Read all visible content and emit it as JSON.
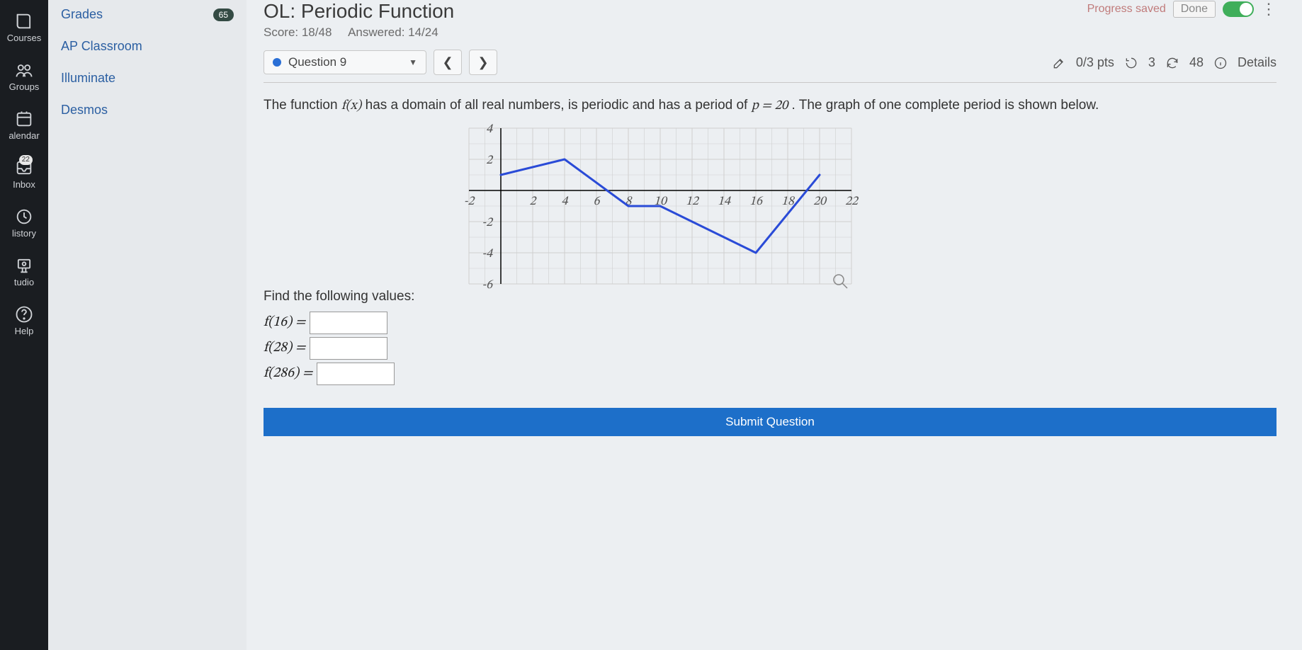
{
  "leftrail": {
    "items": [
      {
        "name": "courses",
        "label": "Courses",
        "icon": "book"
      },
      {
        "name": "groups",
        "label": "Groups",
        "icon": "people"
      },
      {
        "name": "calendar",
        "label": "alendar",
        "icon": "calendar"
      },
      {
        "name": "inbox",
        "label": "Inbox",
        "icon": "inbox",
        "badge": "22"
      },
      {
        "name": "history",
        "label": "listory",
        "icon": "clock"
      },
      {
        "name": "studio",
        "label": "tudio",
        "icon": "studio"
      },
      {
        "name": "help",
        "label": "Help",
        "icon": "help"
      }
    ]
  },
  "secondnav": {
    "items": [
      {
        "label": "Grades",
        "badge": "65"
      },
      {
        "label": "AP Classroom"
      },
      {
        "label": "Illuminate"
      },
      {
        "label": "Desmos"
      }
    ]
  },
  "header": {
    "title": "OL: Periodic Function",
    "score_label": "Score: 18/48",
    "answered_label": "Answered: 14/24",
    "progress_saved": "Progress saved",
    "done_label": "Done"
  },
  "questionbar": {
    "label": "Question 9",
    "pts": "0/3 pts",
    "retries": "3",
    "attempts": "48",
    "details": "Details"
  },
  "question": {
    "text_pre": "The function ",
    "fx": "f(x)",
    "text_mid": " has a domain of all real numbers, is periodic and has a period of ",
    "p_eq": "p = 20",
    "text_post": ". The graph of one complete period is shown below.",
    "find_label": "Find the following values:",
    "answers": [
      {
        "label": "f(16) ="
      },
      {
        "label": "f(28) ="
      },
      {
        "label": "f(286) ="
      }
    ],
    "submit_label": "Submit Question"
  },
  "chart_data": {
    "type": "line",
    "x": [
      0,
      4,
      8,
      10,
      16,
      20
    ],
    "y": [
      1,
      2,
      -1,
      -1,
      -4,
      1
    ],
    "xlim": [
      -2,
      22
    ],
    "ylim": [
      -6,
      4
    ],
    "xticks": [
      -2,
      2,
      4,
      6,
      8,
      10,
      12,
      14,
      16,
      18,
      20,
      22
    ],
    "yticks": [
      4,
      2,
      -2,
      -4,
      -6
    ],
    "title": "",
    "xlabel": "",
    "ylabel": ""
  }
}
